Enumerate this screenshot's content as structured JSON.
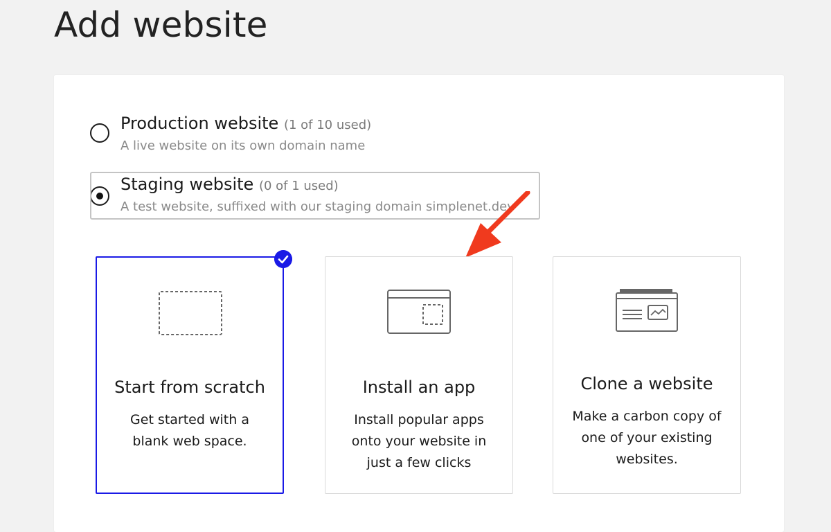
{
  "page": {
    "title": "Add website"
  },
  "options": [
    {
      "title": "Production website",
      "usage": "(1 of 10 used)",
      "description": "A live website on its own domain name",
      "selected": false
    },
    {
      "title": "Staging website",
      "usage": "(0 of 1 used)",
      "description": "A test website, suffixed with our staging domain simplenet.dev",
      "selected": true
    }
  ],
  "tiles": [
    {
      "title": "Start from scratch",
      "description": "Get started with a blank web space.",
      "icon": "dashed-box-icon",
      "selected": true
    },
    {
      "title": "Install an app",
      "description": "Install popular apps onto your website in just a few clicks",
      "icon": "app-window-icon",
      "selected": false
    },
    {
      "title": "Clone a website",
      "description": "Make a carbon copy of one of your existing websites.",
      "icon": "browser-clone-icon",
      "selected": false
    }
  ],
  "colors": {
    "accent": "#1a1ae6",
    "annotation_arrow": "#f03a1e"
  }
}
